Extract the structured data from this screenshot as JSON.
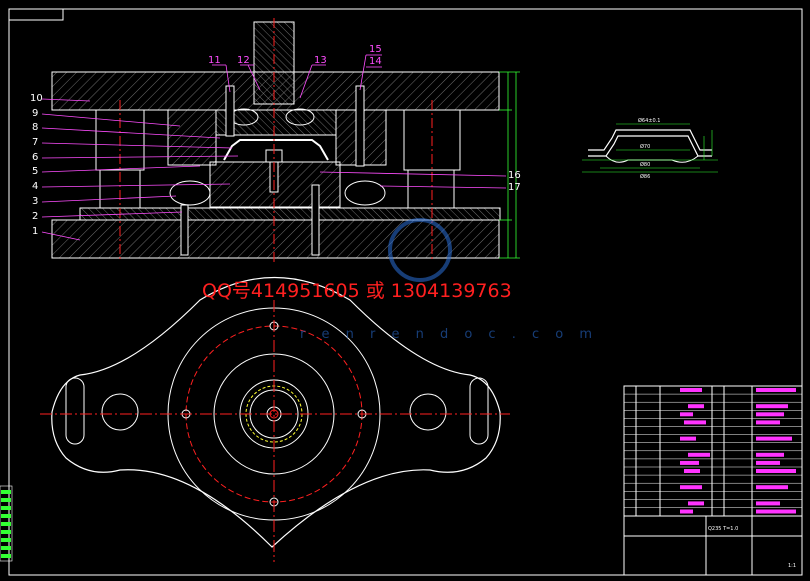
{
  "contact_text": "QQ号414951605  或  1304139763",
  "watermark_url": "r e n r e n d o c . c o m",
  "part_labels": [
    "1",
    "2",
    "3",
    "4",
    "5",
    "6",
    "7",
    "8",
    "9",
    "10"
  ],
  "part_labels_top": [
    "11",
    "12",
    "13",
    "15",
    "14"
  ],
  "part_labels_right": [
    "16",
    "17"
  ],
  "title_block": {
    "material_ref": "Q235 T=1.0",
    "sheet_no": "1:1"
  },
  "colors": {
    "background": "#000000",
    "lines": "#ffffff",
    "centerline": "#ff2020",
    "leaders": "#ff4dff",
    "dims": "#33ff33",
    "hidden": "#ffff33"
  }
}
